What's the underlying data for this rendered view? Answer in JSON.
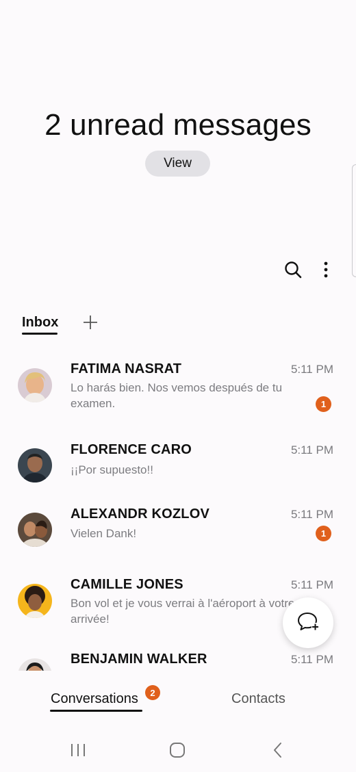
{
  "header": {
    "title": "2 unread messages",
    "view_label": "View"
  },
  "toolbar": {
    "search_icon": "search-icon",
    "more_icon": "more-vertical-icon"
  },
  "tabs": {
    "inbox_label": "Inbox",
    "add_icon": "plus-icon"
  },
  "conversations": [
    {
      "name": "FATIMA NASRAT",
      "time": "5:11 PM",
      "preview": "Lo harás bien. Nos vemos después de tu examen.",
      "unread": "1"
    },
    {
      "name": "FLORENCE CARO",
      "time": "5:11 PM",
      "preview": "¡¡Por supuesto!!",
      "unread": ""
    },
    {
      "name": "ALEXANDR KOZLOV",
      "time": "5:11 PM",
      "preview": "Vielen Dank!",
      "unread": "1"
    },
    {
      "name": "CAMILLE JONES",
      "time": "5:11 PM",
      "preview": "Bon vol et je vous verrai à l'aéroport à votre arrivée!",
      "unread": ""
    },
    {
      "name": "BENJAMIN WALKER",
      "time": "5:11 PM",
      "preview": "",
      "unread": ""
    }
  ],
  "fab": {
    "icon": "new-message-icon"
  },
  "bottom_tabs": {
    "conversations_label": "Conversations",
    "conversations_badge": "2",
    "contacts_label": "Contacts"
  },
  "colors": {
    "badge": "#e0601c",
    "background": "#fcfafc"
  }
}
